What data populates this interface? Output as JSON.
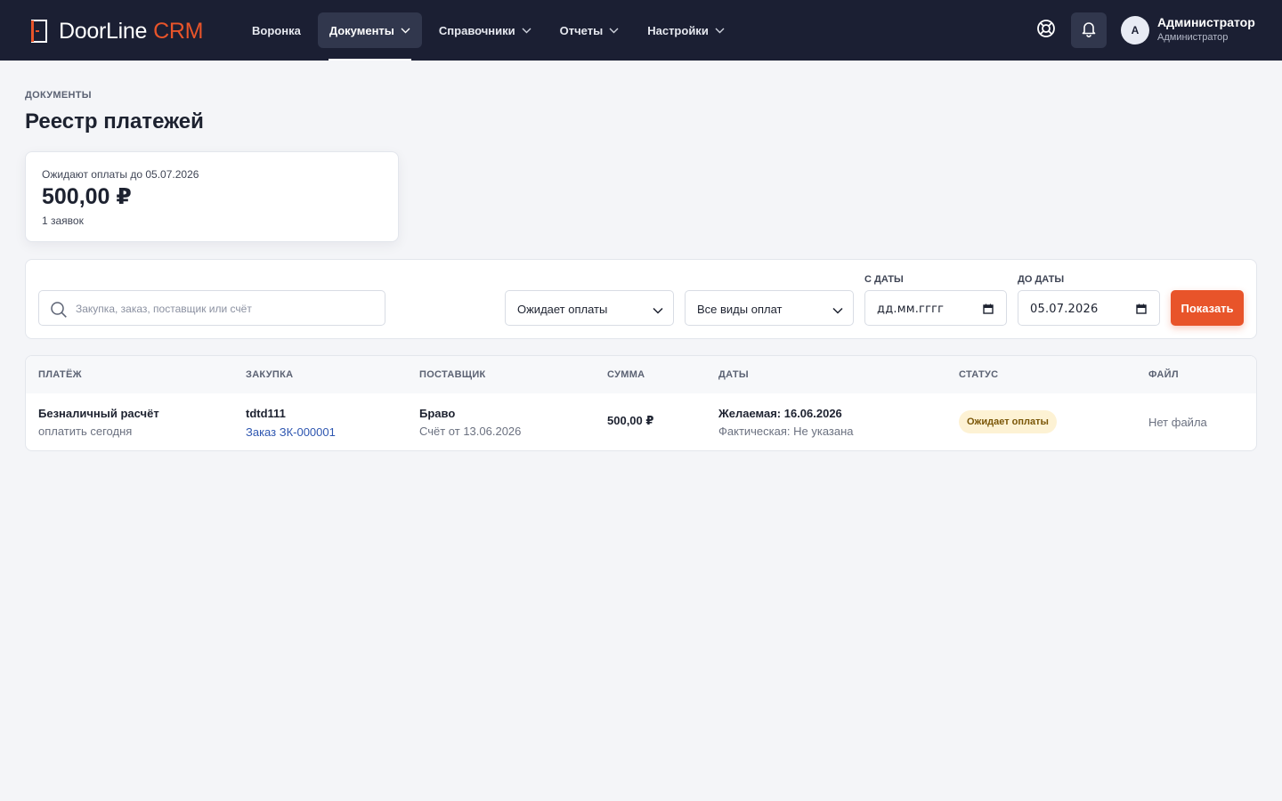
{
  "brand": {
    "name": "DoorLine",
    "suffix": "CRM",
    "accent": "#e8542a"
  },
  "nav": {
    "items": [
      {
        "label": "Воронка",
        "dropdown": false
      },
      {
        "label": "Документы",
        "dropdown": true,
        "active": true
      },
      {
        "label": "Справочники",
        "dropdown": true
      },
      {
        "label": "Отчеты",
        "dropdown": true
      },
      {
        "label": "Настройки",
        "dropdown": true
      }
    ]
  },
  "header_icons": [
    "lifebuoy-icon",
    "bell-icon"
  ],
  "user": {
    "initial": "A",
    "name": "Администратор",
    "role": "Администратор"
  },
  "page": {
    "breadcrumb": "ДОКУМЕНТЫ",
    "title": "Реестр платежей"
  },
  "summary": {
    "label": "Ожидают оплаты до 05.07.2026",
    "amount": "500,00 ₽",
    "count": "1 заявок"
  },
  "filters": {
    "search_placeholder": "Закупка, заказ, поставщик или счёт",
    "status": "Ожидает оплаты",
    "payment_type": "Все виды оплат",
    "date_from_label": "С ДАТЫ",
    "date_from": "дд.мм.гггг",
    "date_to_label": "ДО ДАТЫ",
    "date_to": "05.07.2026",
    "show_button": "Показать"
  },
  "table": {
    "columns": [
      "ПЛАТЁЖ",
      "ЗАКУПКА",
      "ПОСТАВЩИК",
      "СУММА",
      "ДАТЫ",
      "СТАТУС",
      "ФАЙЛ"
    ],
    "rows": [
      {
        "payment": "Безналичный расчёт",
        "payment_note": "оплатить сегодня",
        "purchase": "tdtd111",
        "order_link": "Заказ ЗК-000001",
        "supplier": "Браво",
        "invoice": "Счёт от 13.06.2026",
        "amount": "500,00 ₽",
        "desired_date": "Желаемая: 16.06.2026",
        "actual_date": "Фактическая: Не указана",
        "status": "Ожидает оплаты",
        "file": "Нет файла"
      }
    ]
  },
  "colors": {
    "topbar": "#1b1f33",
    "accent": "#e8542a",
    "link": "#2e56b0",
    "badge_bg": "#fdf2d4"
  }
}
